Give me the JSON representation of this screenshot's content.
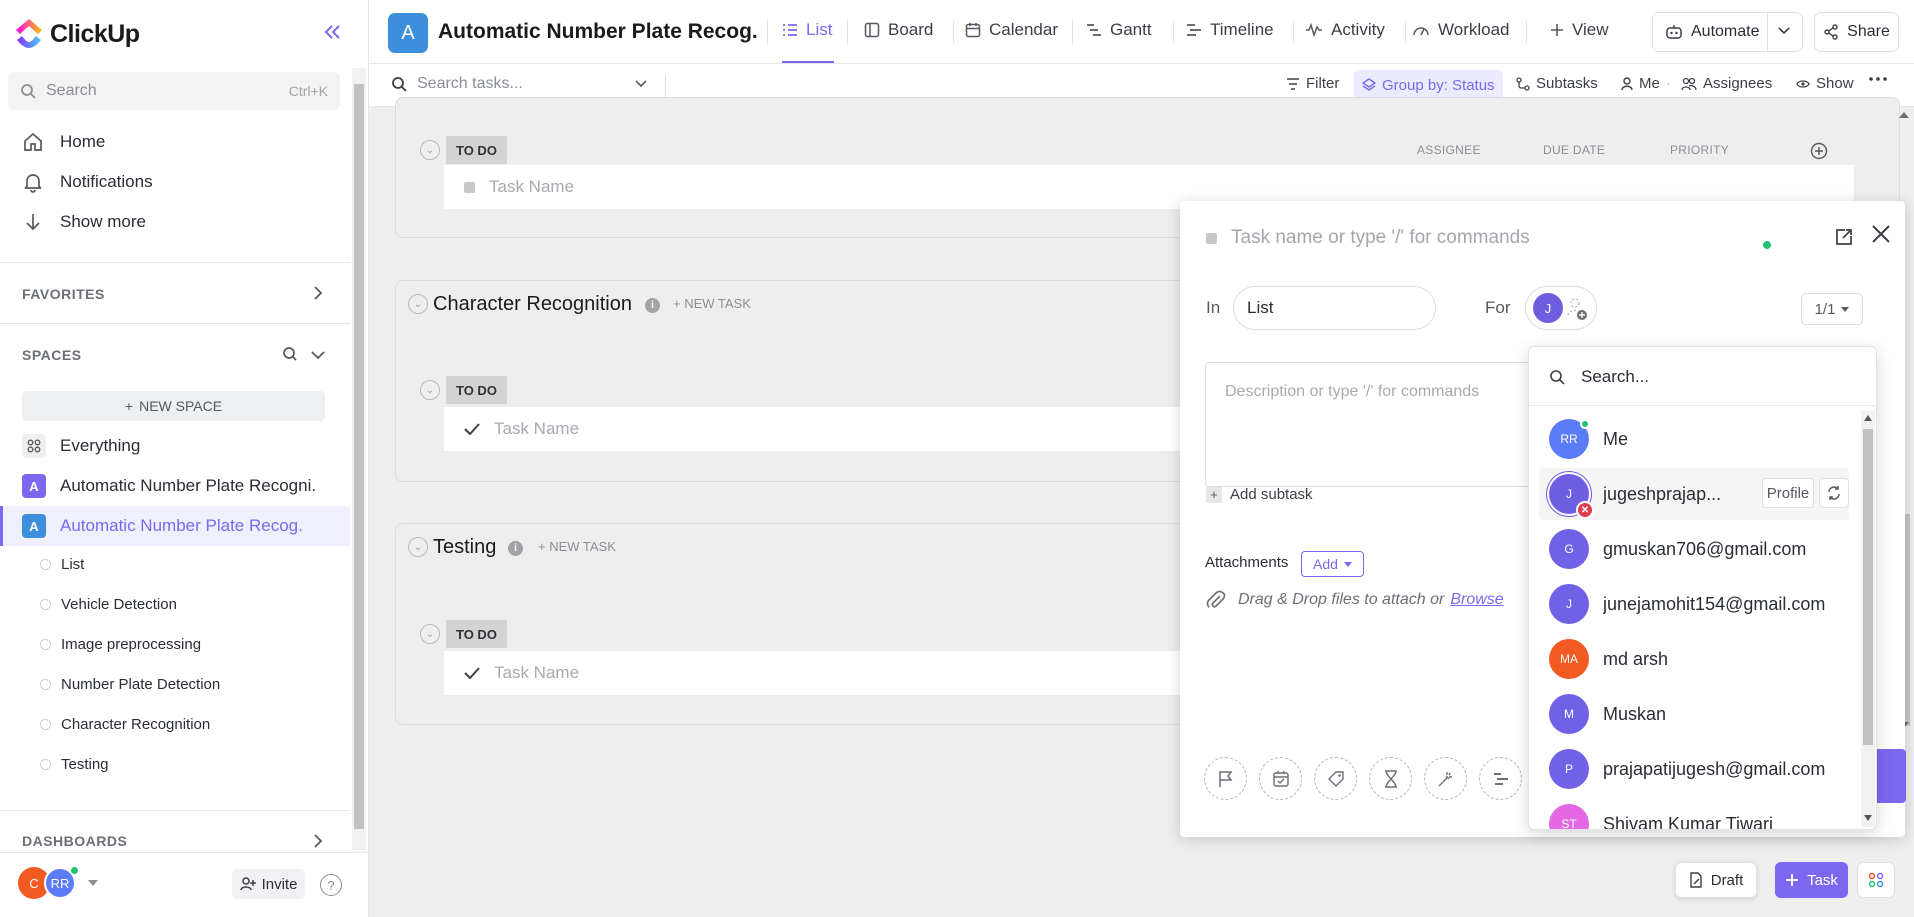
{
  "app": {
    "name": "ClickUp",
    "colors": {
      "accent": "#7b68ee",
      "project": "#3d8fdb",
      "online": "#21c36f"
    }
  },
  "sidebar": {
    "search": {
      "placeholder": "Search",
      "shortcut": "Ctrl+K"
    },
    "nav": [
      {
        "label": "Home",
        "icon": "home-icon"
      },
      {
        "label": "Notifications",
        "icon": "bell-icon"
      },
      {
        "label": "Show more",
        "icon": "arrow-down-icon"
      }
    ],
    "favorites_title": "FAVORITES",
    "spaces_title": "SPACES",
    "new_space_label": "NEW SPACE",
    "spaces": [
      {
        "label": "Everything",
        "icon": "grid-icon"
      },
      {
        "label": "Automatic Number Plate Recogni.",
        "letter": "A",
        "color": "#7b68ee"
      },
      {
        "label": "Automatic Number Plate Recog.",
        "letter": "A",
        "color": "#3d8fdb"
      }
    ],
    "lists": [
      "List",
      "Vehicle Detection",
      "Image preprocessing",
      "Number Plate Detection",
      "Character Recognition",
      "Testing"
    ],
    "dashboards_title": "DASHBOARDS",
    "footer": {
      "user1_initial": "C",
      "user2_initials": "RR",
      "invite_label": "Invite",
      "help_label": "?"
    }
  },
  "header": {
    "project_letter": "A",
    "project_title": "Automatic Number Plate Recog.",
    "tabs": [
      {
        "label": "List",
        "icon": "list-icon",
        "active": true
      },
      {
        "label": "Board",
        "icon": "board-icon"
      },
      {
        "label": "Calendar",
        "icon": "calendar-icon"
      },
      {
        "label": "Gantt",
        "icon": "gantt-icon"
      },
      {
        "label": "Timeline",
        "icon": "timeline-icon"
      },
      {
        "label": "Activity",
        "icon": "activity-icon"
      },
      {
        "label": "Workload",
        "icon": "workload-icon"
      },
      {
        "label": "View",
        "icon": "plus-icon"
      }
    ],
    "automate_label": "Automate",
    "share_label": "Share"
  },
  "toolbar": {
    "search_placeholder": "Search tasks...",
    "filter_label": "Filter",
    "groupby_label": "Group by: Status",
    "subtasks_label": "Subtasks",
    "me_label": "Me",
    "assignees_label": "Assignees",
    "show_label": "Show"
  },
  "main": {
    "columns": {
      "assignee": "ASSIGNEE",
      "due_date": "DUE DATE",
      "priority": "PRIORITY"
    },
    "groups": [
      {
        "title": "",
        "status": "TO DO",
        "task_placeholder": "Task Name"
      },
      {
        "title": "Character Recognition",
        "new_task": "+ NEW TASK",
        "status": "TO DO",
        "task_placeholder": "Task Name"
      },
      {
        "title": "Testing",
        "new_task": "+ NEW TASK",
        "status": "TO DO",
        "task_placeholder": "Task Name"
      }
    ]
  },
  "modal": {
    "title_placeholder": "Task name or type '/' for commands",
    "in_label": "In",
    "in_value": "List",
    "for_label": "For",
    "for_avatar": "J",
    "pager": "1/1",
    "description_placeholder": "Description or type '/' for commands",
    "add_subtask_label": "Add subtask",
    "attachments_label": "Attachments",
    "attach_add_label": "Add",
    "dropzone_text": "Drag & Drop files to attach or",
    "browse_label": "Browse",
    "tools": [
      "flag-icon",
      "calendar-check-icon",
      "tag-icon",
      "hourglass-icon",
      "magic-wand-icon",
      "gantt-bars-icon"
    ]
  },
  "assignee_dropdown": {
    "search_placeholder": "Search...",
    "profile_label": "Profile",
    "people": [
      {
        "initials": "RR",
        "name": "Me",
        "color": "#5b7cf7",
        "online": true
      },
      {
        "initials": "J",
        "name": "jugeshprajap...",
        "color": "#6e5ee0",
        "selected": true
      },
      {
        "initials": "G",
        "name": "gmuskan706@gmail.com",
        "color": "#7062e6"
      },
      {
        "initials": "J",
        "name": "junejamohit154@gmail.com",
        "color": "#7062e6"
      },
      {
        "initials": "MA",
        "name": "md arsh",
        "color": "#f25a22"
      },
      {
        "initials": "M",
        "name": "Muskan",
        "color": "#7062e6"
      },
      {
        "initials": "P",
        "name": "prajapatijugesh@gmail.com",
        "color": "#7062e6"
      },
      {
        "initials": "ST",
        "name": "Shivam Kumar Tiwari",
        "color": "#e468e6"
      }
    ]
  },
  "footer_buttons": {
    "draft_label": "Draft",
    "task_label": "Task"
  }
}
